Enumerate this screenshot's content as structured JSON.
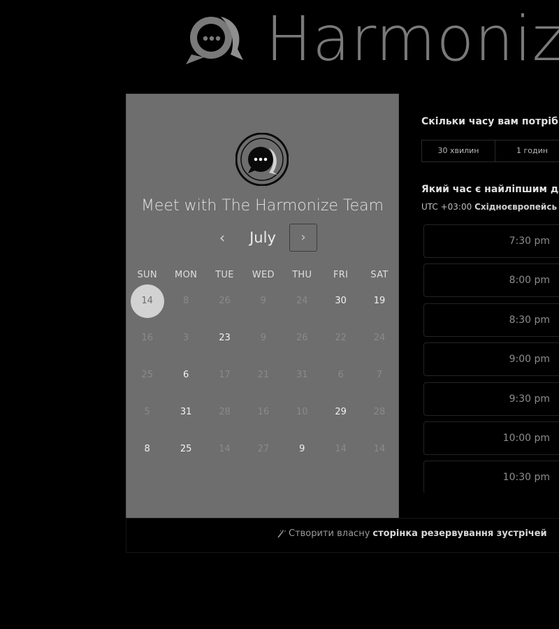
{
  "header": {
    "brand_name": "Harmonize"
  },
  "calendar": {
    "title": "Meet with The Harmonize Team",
    "month": "July",
    "prev_icon": "‹",
    "next_icon": "›",
    "weekdays": [
      "SUN",
      "MON",
      "TUE",
      "WED",
      "THU",
      "FRI",
      "SAT"
    ],
    "weeks": [
      [
        {
          "d": "14",
          "s": "selected"
        },
        {
          "d": "8",
          "s": "muted"
        },
        {
          "d": "26",
          "s": "muted"
        },
        {
          "d": "9",
          "s": "muted"
        },
        {
          "d": "24",
          "s": "muted"
        },
        {
          "d": "30",
          "s": "active"
        },
        {
          "d": "19",
          "s": "active"
        }
      ],
      [
        {
          "d": "16",
          "s": "muted"
        },
        {
          "d": "3",
          "s": "muted"
        },
        {
          "d": "23",
          "s": "active"
        },
        {
          "d": "9",
          "s": "muted"
        },
        {
          "d": "26",
          "s": "muted"
        },
        {
          "d": "22",
          "s": "muted"
        },
        {
          "d": "24",
          "s": "muted"
        }
      ],
      [
        {
          "d": "25",
          "s": "muted"
        },
        {
          "d": "6",
          "s": "active"
        },
        {
          "d": "17",
          "s": "muted"
        },
        {
          "d": "21",
          "s": "muted"
        },
        {
          "d": "31",
          "s": "muted"
        },
        {
          "d": "6",
          "s": "muted"
        },
        {
          "d": "7",
          "s": "muted"
        }
      ],
      [
        {
          "d": "5",
          "s": "muted"
        },
        {
          "d": "31",
          "s": "active"
        },
        {
          "d": "28",
          "s": "muted"
        },
        {
          "d": "16",
          "s": "muted"
        },
        {
          "d": "10",
          "s": "muted"
        },
        {
          "d": "29",
          "s": "active"
        },
        {
          "d": "28",
          "s": "muted"
        }
      ],
      [
        {
          "d": "8",
          "s": "active"
        },
        {
          "d": "25",
          "s": "active"
        },
        {
          "d": "14",
          "s": "muted"
        },
        {
          "d": "27",
          "s": "muted"
        },
        {
          "d": "9",
          "s": "active"
        },
        {
          "d": "14",
          "s": "muted"
        },
        {
          "d": "14",
          "s": "muted"
        }
      ]
    ]
  },
  "booking": {
    "duration_question": "Скільки часу вам потрібн",
    "duration_options": [
      "30 хвилин",
      "1 годин"
    ],
    "time_question": "Який час є найліпшим дл",
    "timezone_offset": "UTC +03:00",
    "timezone_name": "Східноєвропейсь",
    "slots": [
      "7:30 pm",
      "8:00 pm",
      "8:30 pm",
      "9:00 pm",
      "9:30 pm",
      "10:00 pm",
      "10:30 pm"
    ]
  },
  "footer": {
    "link_prefix": "Створити власну",
    "link_strong": "сторінка резервування зустрічей"
  },
  "colors": {
    "panel": "#6e6e6e",
    "background": "#000000",
    "selected_day": "#d2d2d2"
  }
}
